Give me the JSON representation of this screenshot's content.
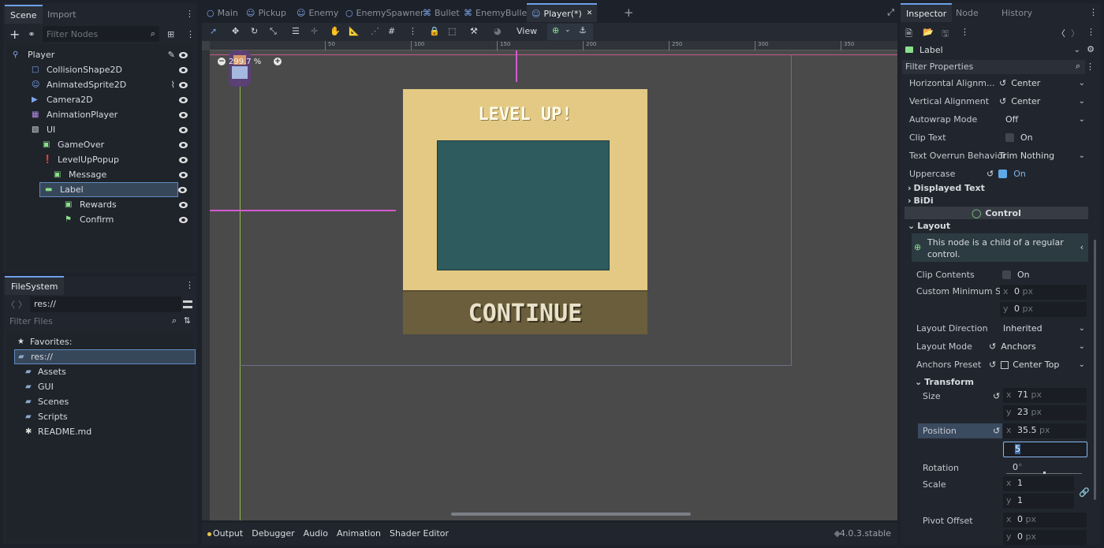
{
  "scene_dock": {
    "tab_scene": "Scene",
    "tab_import": "Import",
    "filter_placeholder": "Filter Nodes",
    "nodes": [
      {
        "label": "Player",
        "icon": "node2d-icon",
        "depth": 0,
        "eye": true,
        "extra": "script-icon"
      },
      {
        "label": "CollisionShape2D",
        "icon": "collision-shape-icon",
        "depth": 1,
        "eye": true
      },
      {
        "label": "AnimatedSprite2D",
        "icon": "animated-sprite-icon",
        "depth": 1,
        "eye": true,
        "extra": "signal-icon"
      },
      {
        "label": "Camera2D",
        "icon": "camera-icon",
        "depth": 1,
        "eye": true
      },
      {
        "label": "AnimationPlayer",
        "icon": "animation-player-icon",
        "depth": 1,
        "eye": true
      },
      {
        "label": "UI",
        "icon": "canvas-layer-icon",
        "depth": 1,
        "eye": true
      },
      {
        "label": "GameOver",
        "icon": "panel-icon",
        "depth": 2,
        "eye": true
      },
      {
        "label": "LevelUpPopup",
        "icon": "popup-icon",
        "depth": 2,
        "eye": true
      },
      {
        "label": "Message",
        "icon": "panel-icon",
        "depth": 3,
        "eye": true
      },
      {
        "label": "Label",
        "icon": "label-icon",
        "depth": 4,
        "eye": true,
        "selected": true
      },
      {
        "label": "Rewards",
        "icon": "panel-icon",
        "depth": 4,
        "eye": true
      },
      {
        "label": "Confirm",
        "icon": "button-icon",
        "depth": 4,
        "eye": true
      }
    ]
  },
  "filesystem": {
    "tab": "FileSystem",
    "path": "res://",
    "filter_placeholder": "Filter Files",
    "items": [
      {
        "label": "Favorites:",
        "icon": "star-icon",
        "depth": 0
      },
      {
        "label": "res://",
        "icon": "folder-icon",
        "depth": 0,
        "selected": true
      },
      {
        "label": "Assets",
        "icon": "folder-icon",
        "depth": 1
      },
      {
        "label": "GUI",
        "icon": "folder-icon",
        "depth": 1
      },
      {
        "label": "Scenes",
        "icon": "folder-icon",
        "depth": 1
      },
      {
        "label": "Scripts",
        "icon": "folder-icon",
        "depth": 1
      },
      {
        "label": "README.md",
        "icon": "file-icon",
        "depth": 1
      }
    ]
  },
  "editor_tabs": [
    "Main",
    "Pickup",
    "Enemy",
    "EnemySpawner",
    "Bullet",
    "EnemyBullet",
    "Player(*)"
  ],
  "active_tab": "Player(*)",
  "toolbar": {
    "view_label": "View"
  },
  "viewport": {
    "zoom": "299.7 %",
    "ruler": [
      "50",
      "100",
      "150",
      "200",
      "250",
      "300",
      "350"
    ],
    "popup_title": "LEVEL UP!",
    "popup_button": "CONTINUE",
    "colors": {
      "popup_bg": "#e3c983",
      "screen": "#2e5b5d",
      "button": "#6b5e3c"
    }
  },
  "bottom": {
    "tabs": [
      "Output",
      "Debugger",
      "Audio",
      "Animation",
      "Shader Editor"
    ],
    "version": "4.0.3.stable"
  },
  "inspector": {
    "tabs": [
      "Inspector",
      "Node",
      "History"
    ],
    "node_name": "Label",
    "filter_placeholder": "Filter Properties",
    "props": {
      "h_align": {
        "label": "Horizontal Alignm...",
        "value": "Center"
      },
      "v_align": {
        "label": "Vertical Alignment",
        "value": "Center"
      },
      "autowrap": {
        "label": "Autowrap Mode",
        "value": "Off"
      },
      "clip_text": {
        "label": "Clip Text",
        "value": "On"
      },
      "overrun": {
        "label": "Text Overrun Behavior",
        "value": "Trim Nothing"
      },
      "uppercase": {
        "label": "Uppercase",
        "value": "On"
      }
    },
    "sections": {
      "displayed_text": "Displayed Text",
      "bidi": "BiDi",
      "control": "Control",
      "layout": "Layout",
      "transform": "Transform"
    },
    "info": "This node is a child of a regular control.",
    "layout": {
      "clip_contents": {
        "label": "Clip Contents",
        "value": "On"
      },
      "custom_min": {
        "label": "Custom Minimum S...",
        "x": "0",
        "y": "0",
        "unit": "px"
      },
      "direction": {
        "label": "Layout Direction",
        "value": "Inherited"
      },
      "mode": {
        "label": "Layout Mode",
        "value": "Anchors"
      },
      "anchors": {
        "label": "Anchors Preset",
        "value": "Center Top"
      }
    },
    "transform": {
      "size": {
        "label": "Size",
        "x": "71",
        "y": "23",
        "unit": "px"
      },
      "position": {
        "label": "Position",
        "x": "35.5",
        "y": "5",
        "unit": "px"
      },
      "rotation": {
        "label": "Rotation",
        "value": "0",
        "unit": "°"
      },
      "scale": {
        "label": "Scale",
        "x": "1",
        "y": "1"
      },
      "pivot": {
        "label": "Pivot Offset",
        "x": "0",
        "y": "0",
        "unit": "px"
      }
    }
  }
}
